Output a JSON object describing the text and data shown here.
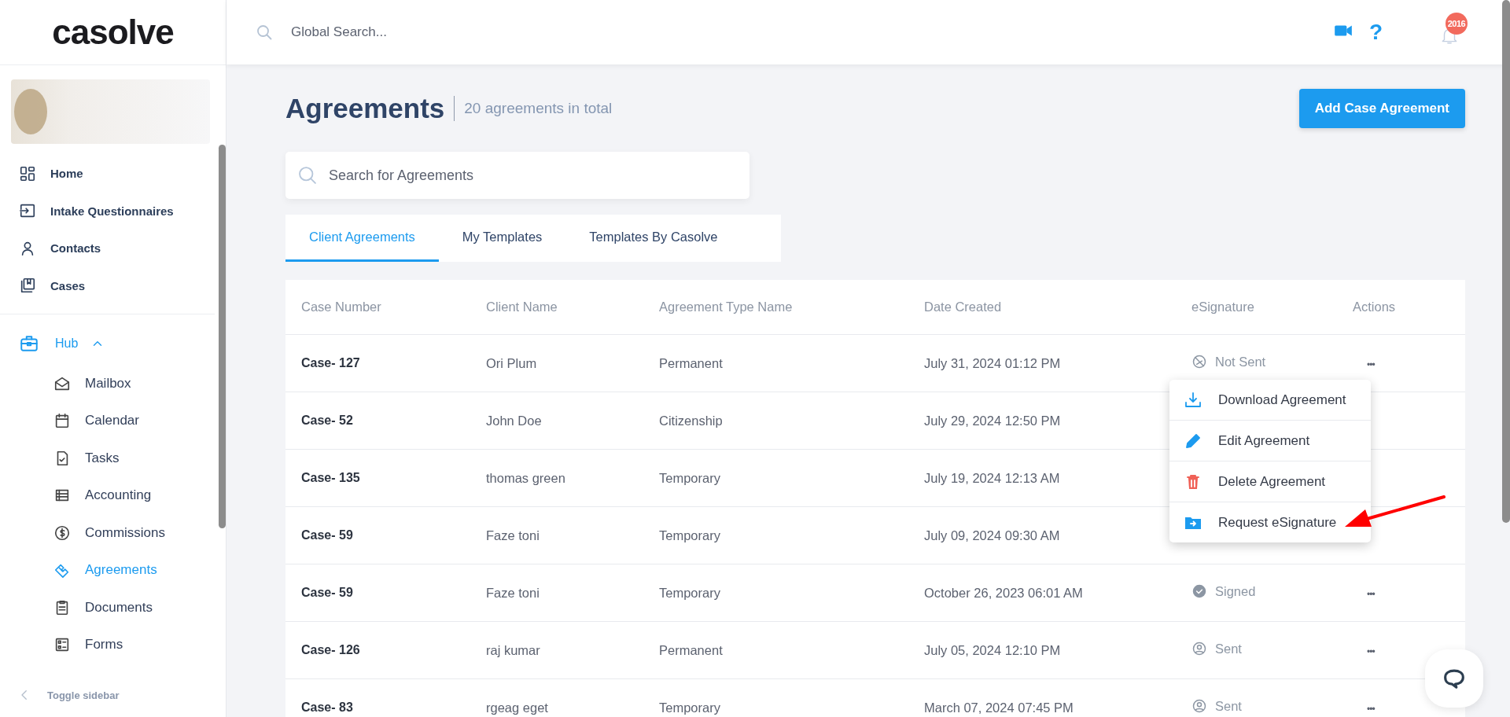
{
  "header": {
    "logo": "casolve",
    "search": {
      "placeholder": "Global Search..."
    },
    "help": "?",
    "notifications": {
      "count": "2016"
    }
  },
  "sidebar": {
    "items": [
      {
        "label": "Home",
        "selected": false
      },
      {
        "label": "Intake Questionnaires",
        "selected": false
      },
      {
        "label": "Contacts",
        "selected": false
      },
      {
        "label": "Cases",
        "selected": false
      }
    ],
    "hub": {
      "label": "Hub",
      "expanded": true,
      "children": [
        {
          "label": "Mailbox",
          "selected": false
        },
        {
          "label": "Calendar",
          "selected": false
        },
        {
          "label": "Tasks",
          "selected": false
        },
        {
          "label": "Accounting",
          "selected": false
        },
        {
          "label": "Commissions",
          "selected": false
        },
        {
          "label": "Agreements",
          "selected": true
        },
        {
          "label": "Documents",
          "selected": false
        },
        {
          "label": "Forms",
          "selected": false
        }
      ]
    },
    "toggle": "Toggle sidebar"
  },
  "page": {
    "title": "Agreements",
    "subtitle": "20 agreements in total",
    "add_button": "Add Case Agreement",
    "search": {
      "placeholder": "Search for Agreements"
    }
  },
  "tabs": [
    {
      "label": "Client Agreements",
      "selected": true
    },
    {
      "label": "My Templates",
      "selected": false
    },
    {
      "label": "Templates By Casolve",
      "selected": false
    }
  ],
  "table": {
    "columns": [
      "Case Number",
      "Client Name",
      "Agreement Type Name",
      "Date Created",
      "eSignature",
      "Actions"
    ],
    "rows": [
      {
        "case": "Case- 127",
        "client": "Ori Plum",
        "type": "Permanent",
        "date": "July 31, 2024 01:12 PM",
        "esignature": {
          "kind": "not_sent",
          "label": "Not Sent"
        },
        "actions": "•••"
      },
      {
        "case": "Case- 52",
        "client": "John Doe",
        "type": "Citizenship",
        "date": "July 29, 2024 12:50 PM"
      },
      {
        "case": "Case- 135",
        "client": "thomas green",
        "type": "Temporary",
        "date": "July 19, 2024 12:13 AM"
      },
      {
        "case": "Case- 59",
        "client": "Faze toni",
        "type": "Temporary",
        "date": "July 09, 2024 09:30 AM"
      },
      {
        "case": "Case- 59",
        "client": "Faze toni",
        "type": "Temporary",
        "date": "October 26, 2023 06:01 AM",
        "esignature": {
          "kind": "signed",
          "label": "Signed"
        },
        "actions": "•••"
      },
      {
        "case": "Case- 126",
        "client": "raj kumar",
        "type": "Permanent",
        "date": "July 05, 2024 12:10 PM",
        "esignature": {
          "kind": "sent",
          "label": "Sent"
        },
        "actions": "•••"
      },
      {
        "case": "Case- 83",
        "client": "rgeag eget",
        "type": "Temporary",
        "date": "March 07, 2024 07:45 PM",
        "esignature": {
          "kind": "sent",
          "label": "Sent"
        },
        "actions": "•••"
      }
    ]
  },
  "menu": {
    "items": [
      {
        "kind": "download",
        "label": "Download Agreement"
      },
      {
        "kind": "edit",
        "label": "Edit Agreement"
      },
      {
        "kind": "delete",
        "label": "Delete Agreement"
      },
      {
        "kind": "request",
        "label": "Request eSignature"
      }
    ]
  }
}
